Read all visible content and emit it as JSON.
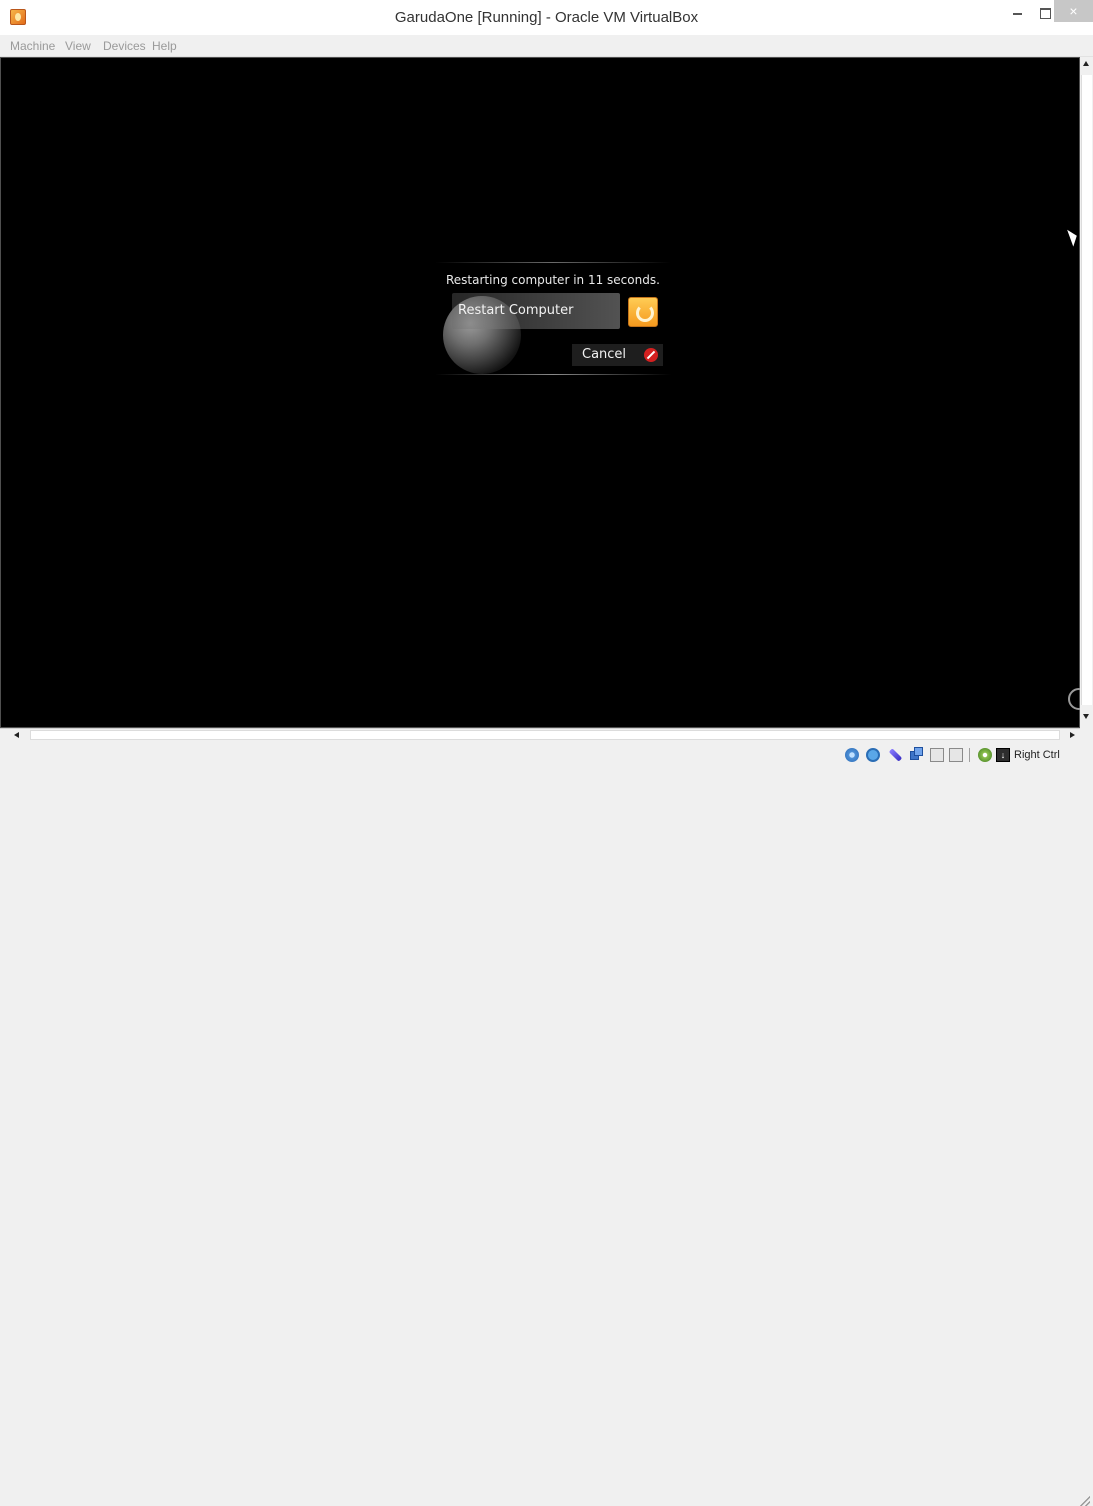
{
  "window": {
    "title": "GarudaOne [Running] - Oracle VM VirtualBox",
    "controls": {
      "minimize": "",
      "maximize": "",
      "close": "×"
    }
  },
  "menubar": {
    "items": [
      {
        "label": "Machine"
      },
      {
        "label": "View"
      },
      {
        "label": "Devices"
      },
      {
        "label": "Help"
      }
    ]
  },
  "guest": {
    "dialog": {
      "message": "Restarting computer in 11 seconds.",
      "restart_label": "Restart Computer",
      "cancel_label": "Cancel"
    }
  },
  "statusbar": {
    "icons": [
      "hard-disk-icon",
      "optical-drive-icon",
      "usb-icon",
      "network-icon",
      "shared-folders-icon",
      "display-icon",
      "mouse-integration-icon",
      "keyboard-capture-icon"
    ],
    "host_key": "Right Ctrl"
  },
  "colors": {
    "guest_background": "#000000",
    "restart_icon": "#f5a623",
    "cancel_icon": "#d42020"
  }
}
